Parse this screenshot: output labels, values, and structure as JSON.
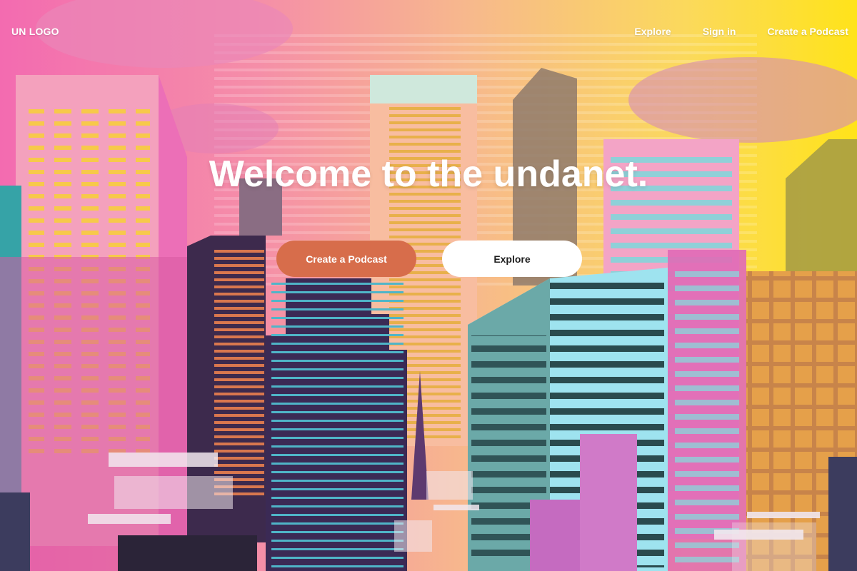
{
  "header": {
    "logo": "UN LOGO",
    "nav": [
      {
        "label": "Explore"
      },
      {
        "label": "Sign in"
      },
      {
        "label": "Create a Podcast"
      }
    ]
  },
  "hero": {
    "title": "Welcome to the undanet.",
    "primary_button": "Create a Podcast",
    "secondary_button": "Explore"
  },
  "background": {
    "illustration": "city-skyline-illustration",
    "colors": {
      "pink": "#f36bb0",
      "yellow": "#ffe31a",
      "purple": "#3b2a55",
      "teal": "#36a3a7",
      "cyan": "#9ee3ef",
      "orange_button": "#d76d4b"
    }
  }
}
